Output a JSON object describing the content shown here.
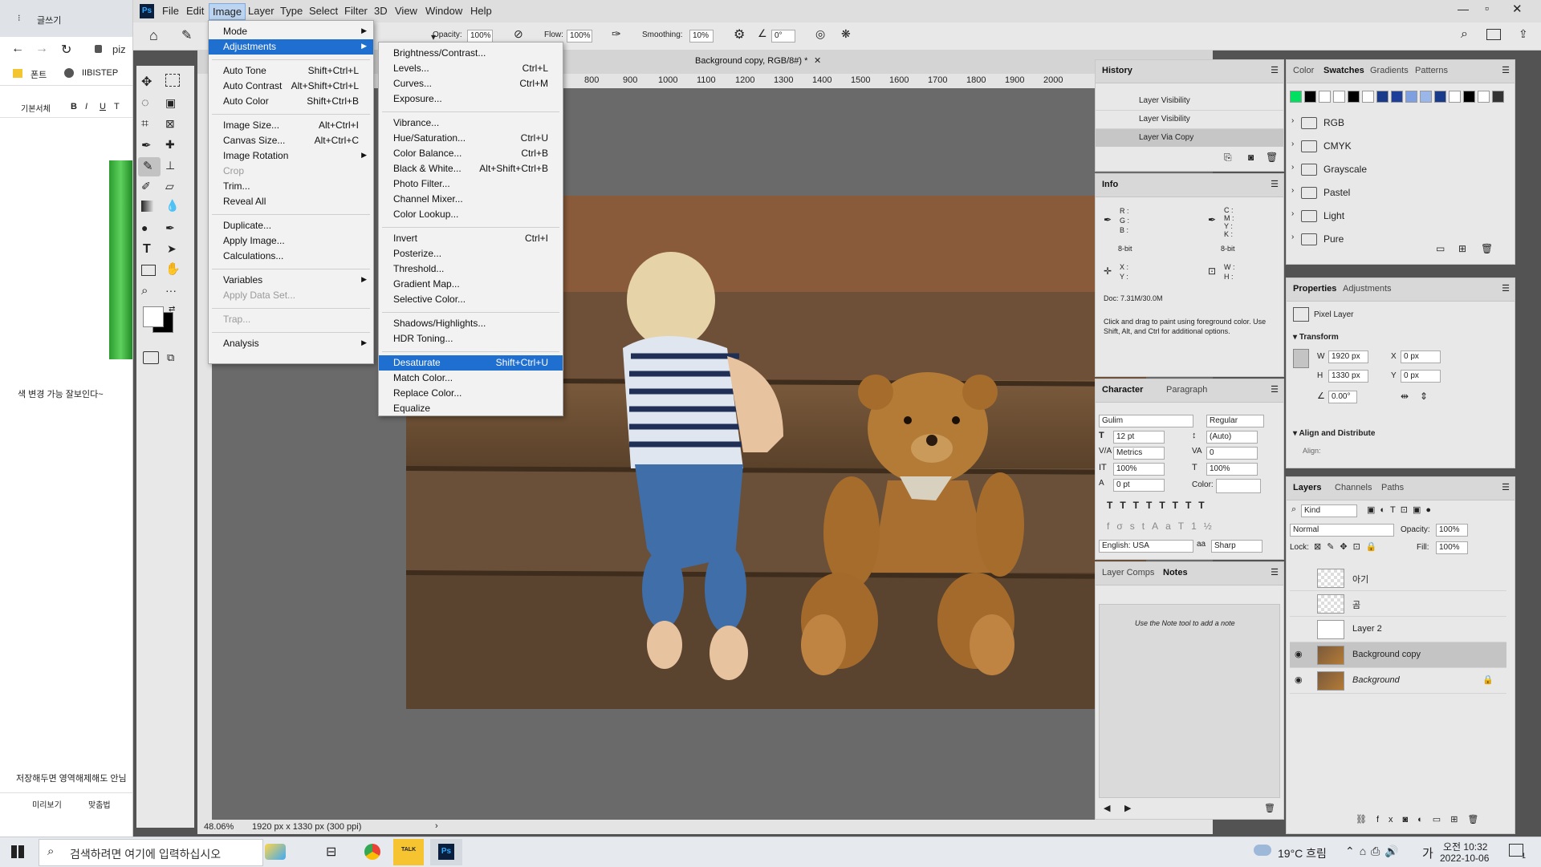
{
  "browser": {
    "tab_title": "글쓰기",
    "address_text": "piz",
    "bookmarks": [
      "폰트",
      "IIBISTEP"
    ],
    "editor_toolbar": [
      "기본서체",
      "B",
      "I",
      "U",
      "T"
    ],
    "note_text": "색 변경 가능 잘보인다~",
    "bottom_text": "저장해두면 영역해제해도 안님",
    "bottom_buttons": [
      "미리보기",
      "맞춤법"
    ]
  },
  "photoshop": {
    "logo": "Ps",
    "menubar": [
      "File",
      "Edit",
      "Image",
      "Layer",
      "Type",
      "Select",
      "Filter",
      "3D",
      "View",
      "Window",
      "Help"
    ],
    "options": {
      "opacity_label": "Opacity:",
      "opacity_value": "100%",
      "flow_label": "Flow:",
      "flow_value": "100%",
      "smoothing_label": "Smoothing:",
      "smoothing_value": "10%",
      "angle_value": "0°"
    },
    "doc_tab": "Background copy, RGB/8#) *",
    "ruler_top": [
      "800",
      "900",
      "1000",
      "1100",
      "1200",
      "1300",
      "1400",
      "1500",
      "1600",
      "1700",
      "1800",
      "1900",
      "2000"
    ],
    "status": {
      "zoom": "48.06%",
      "doc_info": "1920 px x 1330 px (300 ppi)"
    },
    "image_menu": [
      {
        "label": "Mode",
        "shortcut": "",
        "submenu": true
      },
      {
        "label": "Adjustments",
        "shortcut": "",
        "submenu": true,
        "highlight": true
      },
      {
        "label": "Auto Tone",
        "shortcut": "Shift+Ctrl+L"
      },
      {
        "label": "Auto Contrast",
        "shortcut": "Alt+Shift+Ctrl+L"
      },
      {
        "label": "Auto Color",
        "shortcut": "Shift+Ctrl+B"
      },
      {
        "label": "Image Size...",
        "shortcut": "Alt+Ctrl+I"
      },
      {
        "label": "Canvas Size...",
        "shortcut": "Alt+Ctrl+C"
      },
      {
        "label": "Image Rotation",
        "shortcut": "",
        "submenu": true
      },
      {
        "label": "Crop",
        "shortcut": "",
        "disabled": true
      },
      {
        "label": "Trim...",
        "shortcut": ""
      },
      {
        "label": "Reveal All",
        "shortcut": ""
      },
      {
        "label": "Duplicate...",
        "shortcut": ""
      },
      {
        "label": "Apply Image...",
        "shortcut": ""
      },
      {
        "label": "Calculations...",
        "shortcut": ""
      },
      {
        "label": "Variables",
        "shortcut": "",
        "submenu": true
      },
      {
        "label": "Apply Data Set...",
        "shortcut": "",
        "disabled": true
      },
      {
        "label": "Trap...",
        "shortcut": "",
        "disabled": true
      },
      {
        "label": "Analysis",
        "shortcut": "",
        "submenu": true
      }
    ],
    "adjust_menu": [
      {
        "label": "Brightness/Contrast...",
        "shortcut": ""
      },
      {
        "label": "Levels...",
        "shortcut": "Ctrl+L"
      },
      {
        "label": "Curves...",
        "shortcut": "Ctrl+M"
      },
      {
        "label": "Exposure...",
        "shortcut": ""
      },
      {
        "label": "Vibrance...",
        "shortcut": ""
      },
      {
        "label": "Hue/Saturation...",
        "shortcut": "Ctrl+U"
      },
      {
        "label": "Color Balance...",
        "shortcut": "Ctrl+B"
      },
      {
        "label": "Black & White...",
        "shortcut": "Alt+Shift+Ctrl+B"
      },
      {
        "label": "Photo Filter...",
        "shortcut": ""
      },
      {
        "label": "Channel Mixer...",
        "shortcut": ""
      },
      {
        "label": "Color Lookup...",
        "shortcut": ""
      },
      {
        "label": "Invert",
        "shortcut": "Ctrl+I"
      },
      {
        "label": "Posterize...",
        "shortcut": ""
      },
      {
        "label": "Threshold...",
        "shortcut": ""
      },
      {
        "label": "Gradient Map...",
        "shortcut": ""
      },
      {
        "label": "Selective Color...",
        "shortcut": ""
      },
      {
        "label": "Shadows/Highlights...",
        "shortcut": ""
      },
      {
        "label": "HDR Toning...",
        "shortcut": ""
      },
      {
        "label": "Desaturate",
        "shortcut": "Shift+Ctrl+U",
        "highlight": true
      },
      {
        "label": "Match Color...",
        "shortcut": ""
      },
      {
        "label": "Replace Color...",
        "shortcut": ""
      },
      {
        "label": "Equalize",
        "shortcut": ""
      }
    ],
    "history": {
      "title": "History",
      "items": [
        "Layer Visibility",
        "Layer Visibility",
        "Layer Via Copy"
      ]
    },
    "info": {
      "title": "Info",
      "rgb": "R :\nG :\nB :",
      "cmyk": "C :\nM :\nY :\nK :",
      "bit1": "8-bit",
      "bit2": "8-bit",
      "xy": "X :\nY :",
      "wh": "W :\nH :",
      "doc": "Doc: 7.31M/30.0M",
      "hint": "Click and drag to paint using foreground color.  Use Shift, Alt, and Ctrl for additional options."
    },
    "character": {
      "tabs": [
        "Character",
        "Paragraph"
      ],
      "font": "Gulim",
      "style": "Regular",
      "size": "12 pt",
      "leading": "(Auto)",
      "kerning": "Metrics",
      "tracking": "0",
      "vscale": "100%",
      "hscale": "100%",
      "baseline": "0 pt",
      "color_label": "Color:",
      "lang": "English: USA",
      "aa_label": "aa",
      "aa": "Sharp"
    },
    "notes": {
      "tabs": [
        "Layer Comps",
        "Notes"
      ],
      "hint": "Use the Note tool to add a note"
    },
    "swatches": {
      "tabs": [
        "Color",
        "Swatches",
        "Gradients",
        "Patterns"
      ],
      "colors": [
        "#00e060",
        "#000000",
        "#ffffff",
        "#ffffff",
        "#000000",
        "#ffffff",
        "#1a3a8a",
        "#1d3f99",
        "#7ea0e0",
        "#9bb6e8",
        "#1a3a8a",
        "#ffffff",
        "#000000",
        "#ffffff",
        "#333333"
      ],
      "folders": [
        "RGB",
        "CMYK",
        "Grayscale",
        "Pastel",
        "Light",
        "Pure"
      ]
    },
    "properties": {
      "tabs": [
        "Properties",
        "Adjustments"
      ],
      "kind": "Pixel Layer",
      "transform": "Transform",
      "w_label": "W",
      "w": "1920 px",
      "h_label": "H",
      "h": "1330 px",
      "x_label": "X",
      "x": "0 px",
      "y_label": "Y",
      "y": "0 px",
      "angle": "0.00°",
      "align": "Align and Distribute",
      "align_label": "Align:"
    },
    "layers": {
      "tabs": [
        "Layers",
        "Channels",
        "Paths"
      ],
      "kind": "Kind",
      "blend": "Normal",
      "opacity_label": "Opacity:",
      "opacity": "100%",
      "lock_label": "Lock:",
      "fill_label": "Fill:",
      "fill": "100%",
      "items": [
        {
          "name": "아기",
          "visible": false
        },
        {
          "name": "곰",
          "visible": false
        },
        {
          "name": "Layer 2",
          "visible": false
        },
        {
          "name": "Background copy",
          "visible": true,
          "selected": true
        },
        {
          "name": "Background",
          "visible": true,
          "locked": true
        }
      ]
    }
  },
  "taskbar": {
    "search_placeholder": "검색하려면 여기에 입력하십시오",
    "weather": "19°C 흐림",
    "ime": "가",
    "ampm": "오전 10:32",
    "date": "2022-10-06",
    "notify": "1",
    "talk": "TALK",
    "ps": "Ps"
  }
}
